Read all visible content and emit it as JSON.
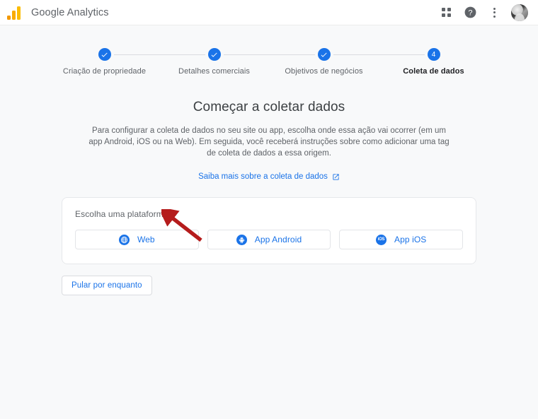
{
  "header": {
    "brand_title": "Google Analytics",
    "logo_name": "google-analytics-logo",
    "actions": [
      {
        "name": "apps-grid-icon",
        "label": "Google apps"
      },
      {
        "name": "help-icon",
        "label": "Ajuda"
      },
      {
        "name": "more-options-icon",
        "label": "Mais opções"
      },
      {
        "name": "avatar",
        "label": "Conta do Google"
      }
    ]
  },
  "stepper": {
    "current_step": 4,
    "steps": [
      {
        "number": "1",
        "label": "Criação de propriedade",
        "state": "complete"
      },
      {
        "number": "2",
        "label": "Detalhes comerciais",
        "state": "complete"
      },
      {
        "number": "3",
        "label": "Objetivos de negócios",
        "state": "complete"
      },
      {
        "number": "4",
        "label": "Coleta de dados",
        "state": "current"
      }
    ]
  },
  "main": {
    "title": "Começar a coletar dados",
    "description": "Para configurar a coleta de dados no seu site ou app, escolha onde essa ação vai ocorrer (em um app Android, iOS ou na Web). Em seguida, você receberá instruções sobre como adicionar uma tag de coleta de dados a essa origem.",
    "learn_more_label": "Saiba mais sobre a coleta de dados",
    "learn_more_icon": "external-link-icon",
    "platform_card": {
      "label": "Escolha uma plataforma",
      "options": [
        {
          "id": "web",
          "label": "Web",
          "icon": "globe-icon"
        },
        {
          "id": "android",
          "label": "App Android",
          "icon": "android-icon"
        },
        {
          "id": "ios",
          "label": "App iOS",
          "icon": "ios-icon",
          "icon_text": "iOS"
        }
      ]
    },
    "skip_label": "Pular por enquanto"
  },
  "annotation": {
    "arrow_color": "#b51c1c",
    "arrow_target": "web-platform-button"
  },
  "colors": {
    "accent_blue": "#1a73e8",
    "page_background": "#f8f9fa",
    "header_background": "#ffffff",
    "text_primary": "#3c4043",
    "text_secondary": "#5f6368",
    "border": "#dadce0"
  }
}
